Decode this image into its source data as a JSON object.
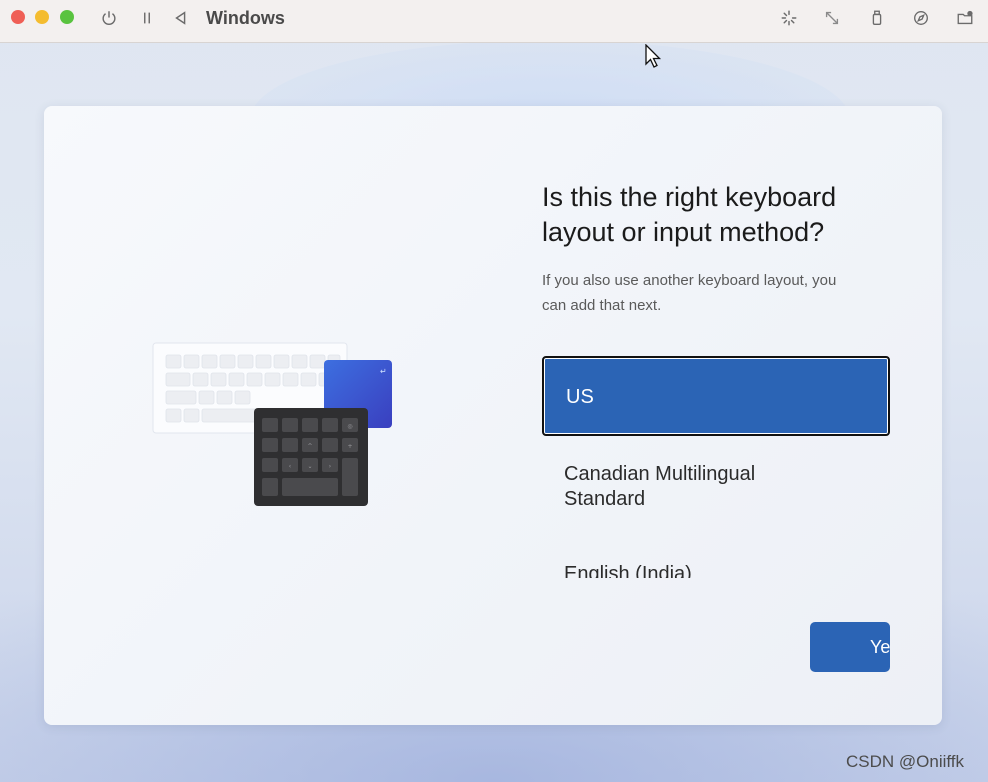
{
  "window": {
    "title": "Windows",
    "traffic_lights": [
      "#ef5f56",
      "#f4bc2f",
      "#59c33f"
    ],
    "toolbar_icons_left": [
      "power-icon",
      "pause-icon",
      "back-triangle-icon"
    ],
    "toolbar_icons_right": [
      "spinner-icon",
      "resize-arrows-icon",
      "usb-icon",
      "safari-compass-icon",
      "folder-share-icon"
    ]
  },
  "setup": {
    "heading_line1": "Is this the right keyboard",
    "heading_line2": "layout or input method?",
    "subtitle_line1": "If you also use another keyboard layout, you",
    "subtitle_line2": "can add that next.",
    "layouts": [
      {
        "label": "US",
        "selected": true
      },
      {
        "label": "Canadian Multilingual",
        "label_line2": "Standard",
        "selected": false
      },
      {
        "label": "English (India)",
        "selected": false
      }
    ],
    "next_button": "Yes",
    "accent": "#2b64b5"
  },
  "watermark": "CSDN @Oniiffk",
  "colors": {
    "titlebar": "#f3f0ef",
    "card": "#f4f6fa"
  }
}
